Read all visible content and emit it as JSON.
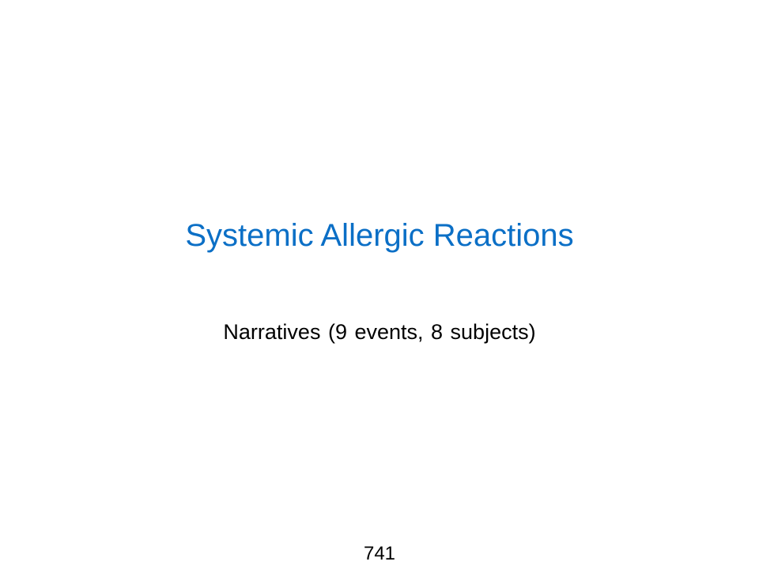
{
  "slide": {
    "title": "Systemic Allergic Reactions",
    "subtitle": "Narratives (9 events, 8 subjects)",
    "page_number": "741"
  },
  "colors": {
    "title": "#0b6fc6",
    "text": "#000000",
    "background": "#ffffff"
  }
}
